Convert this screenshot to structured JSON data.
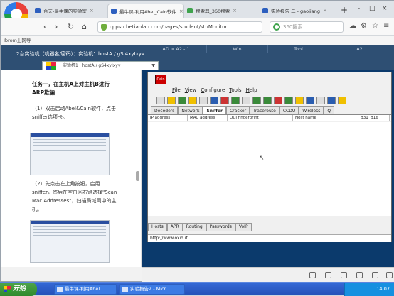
{
  "browser": {
    "tabs": [
      {
        "label": "合天-最牛课的实验室",
        "color": "#2d5fbf",
        "active": false
      },
      {
        "label": "最牛课-利用Abel_Cain软件",
        "color": "#2d5fbf",
        "active": true
      },
      {
        "label": "搜索器_360搜索",
        "color": "#3fa34d",
        "active": false
      },
      {
        "label": "实验报告 二 - gaojiang",
        "color": "#2d5fbf",
        "active": false
      }
    ],
    "new_tab": "+",
    "win_controls": [
      "-",
      "□",
      "×"
    ],
    "url": "cppsu.hetianlab.com/pages/student/stuMonitor",
    "search_placeholder": "360搜索",
    "bookmark": "Ibrom上网导",
    "nav_icons": [
      "back-icon",
      "forward-icon",
      "refresh-icon",
      "home-icon"
    ]
  },
  "lab": {
    "info": "2台实验机（机器名/密码）：实验机1 hostA / gS 4xyIxyv",
    "vm_tabs": [
      "AD > A2 - 1",
      "Win",
      "Tool",
      "A2"
    ],
    "vm_select": "实验机1 · hostA / gS4xyIxyv"
  },
  "guide": {
    "task": "任务一，在主机A上对主机B进行ARP欺骗",
    "step1": "（1）双击启动Abel&Cain软件，点击sniffer选项卡。",
    "step2": "（2）先点击左上角按钮，启用sniffer，然后在空白区右键选择\"Scan Mac Addresses\"，扫描局域网中的主机。"
  },
  "cain": {
    "logo": "Cain",
    "menus": [
      "File",
      "View",
      "Configure",
      "Tools",
      "Help"
    ],
    "tabs": [
      "Decoders",
      "Network",
      "Sniffer",
      "Cracker",
      "Traceroute",
      "CCDU",
      "Wireless",
      "Q"
    ],
    "active_tab": "Sniffer",
    "columns": [
      "IP address",
      "MAC address",
      "OUI fingerprint",
      "Host name",
      "B31",
      "B16"
    ],
    "bottom_tabs": [
      "Hosts",
      "APR",
      "Routing",
      "Passwords",
      "VoIP"
    ],
    "status": "http://www.oxid.it"
  },
  "taskbar": {
    "start": "开始",
    "buttons": [
      "最牛课-利用Abel...",
      "实验报告2 - Micr..."
    ],
    "clock": "14:07"
  }
}
